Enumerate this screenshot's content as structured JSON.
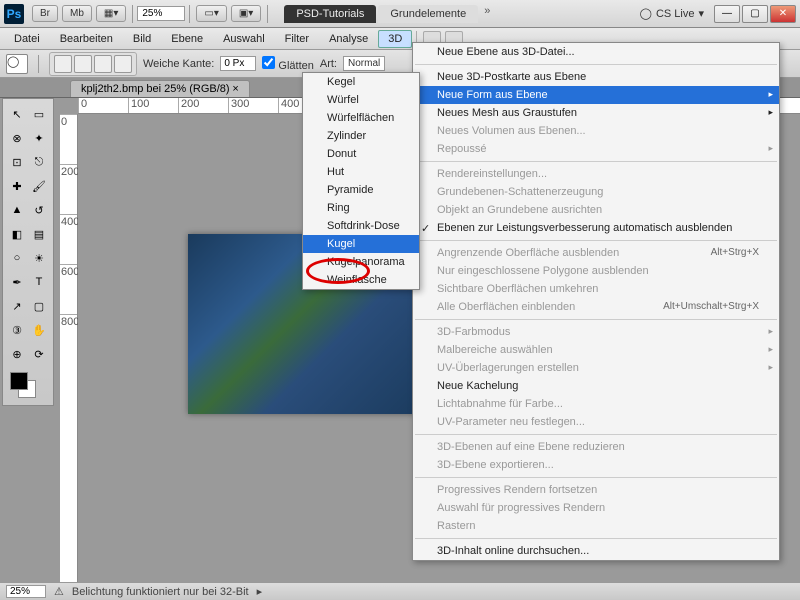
{
  "app": {
    "logo": "Ps",
    "zoom": "25%"
  },
  "titlebar": {
    "btns": [
      "Br",
      "Mb"
    ],
    "tabs": [
      "PSD-Tutorials",
      "Grundelemente"
    ],
    "cslive": "CS Live"
  },
  "menubar": {
    "items": [
      "Datei",
      "Bearbeiten",
      "Bild",
      "Ebene",
      "Auswahl",
      "Filter",
      "Analyse",
      "3D"
    ]
  },
  "options": {
    "weiche_kante_label": "Weiche Kante:",
    "weiche_kante_value": "0 Px",
    "glaetten": "Glätten",
    "art_label": "Art:",
    "art_value": "Normal"
  },
  "doc_tab": "kplj2th2.bmp bei 25% (RGB/8)",
  "ruler_h": [
    "0",
    "100",
    "200",
    "300",
    "400"
  ],
  "ruler_v": [
    "0",
    "200",
    "400",
    "600",
    "800"
  ],
  "submenu": {
    "items": [
      "Kegel",
      "Würfel",
      "Würfelflächen",
      "Zylinder",
      "Donut",
      "Hut",
      "Pyramide",
      "Ring",
      "Softdrink-Dose",
      "Kugel",
      "Kugelpanorama",
      "Weinflasche"
    ],
    "highlight_index": 9
  },
  "mainmenu": {
    "sections": [
      [
        {
          "label": "Neue Ebene aus 3D-Datei...",
          "enabled": true
        }
      ],
      [
        {
          "label": "Neue 3D-Postkarte aus Ebene",
          "enabled": true
        },
        {
          "label": "Neue Form aus Ebene",
          "enabled": true,
          "arrow": true,
          "highlight": true
        },
        {
          "label": "Neues Mesh aus Graustufen",
          "enabled": true,
          "arrow": true
        },
        {
          "label": "Neues Volumen aus Ebenen...",
          "enabled": false
        },
        {
          "label": "Repoussé",
          "enabled": false,
          "arrow": true
        }
      ],
      [
        {
          "label": "Rendereinstellungen...",
          "enabled": false
        },
        {
          "label": "Grundebenen-Schattenerzeugung",
          "enabled": false
        },
        {
          "label": "Objekt an Grundebene ausrichten",
          "enabled": false
        },
        {
          "label": "Ebenen zur Leistungsverbesserung automatisch ausblenden",
          "enabled": true,
          "check": true
        }
      ],
      [
        {
          "label": "Angrenzende Oberfläche ausblenden",
          "enabled": false,
          "shortcut": "Alt+Strg+X"
        },
        {
          "label": "Nur eingeschlossene Polygone ausblenden",
          "enabled": false
        },
        {
          "label": "Sichtbare Oberflächen umkehren",
          "enabled": false
        },
        {
          "label": "Alle Oberflächen einblenden",
          "enabled": false,
          "shortcut": "Alt+Umschalt+Strg+X"
        }
      ],
      [
        {
          "label": "3D-Farbmodus",
          "enabled": false,
          "arrow": true
        },
        {
          "label": "Malbereiche auswählen",
          "enabled": false,
          "arrow": true
        },
        {
          "label": "UV-Überlagerungen erstellen",
          "enabled": false,
          "arrow": true
        },
        {
          "label": "Neue Kachelung",
          "enabled": true
        },
        {
          "label": "Lichtabnahme für Farbe...",
          "enabled": false
        },
        {
          "label": "UV-Parameter neu festlegen...",
          "enabled": false
        }
      ],
      [
        {
          "label": "3D-Ebenen auf eine Ebene reduzieren",
          "enabled": false
        },
        {
          "label": "3D-Ebene exportieren...",
          "enabled": false
        }
      ],
      [
        {
          "label": "Progressives Rendern fortsetzen",
          "enabled": false
        },
        {
          "label": "Auswahl für progressives Rendern",
          "enabled": false
        },
        {
          "label": "Rastern",
          "enabled": false
        }
      ],
      [
        {
          "label": "3D-Inhalt online durchsuchen...",
          "enabled": true
        }
      ]
    ]
  },
  "statusbar": {
    "zoom": "25%",
    "msg": "Belichtung funktioniert nur bei 32-Bit"
  },
  "tools": [
    "move",
    "marquee",
    "lasso",
    "wand",
    "crop",
    "eyedrop",
    "heal",
    "brush",
    "stamp",
    "history",
    "eraser",
    "gradient",
    "blur",
    "dodge",
    "pen",
    "type",
    "path",
    "shape",
    "3d",
    "hand",
    "zoom",
    "rotate"
  ]
}
